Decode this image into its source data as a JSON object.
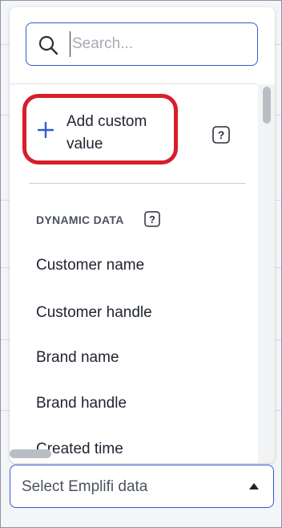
{
  "search": {
    "placeholder": "Search..."
  },
  "menu": {
    "add_custom_label": "Add custom value",
    "section_header": "DYNAMIC DATA",
    "items": [
      "Customer name",
      "Customer handle",
      "Brand name",
      "Brand handle",
      "Created time"
    ]
  },
  "select": {
    "label": "Select Emplifi data"
  },
  "colors": {
    "accent": "#2f5dc9",
    "highlight": "#d71e2b",
    "text": "#1e2330"
  },
  "icons": {
    "search": "search-icon",
    "plus": "plus-icon",
    "help": "help-icon",
    "caret": "caret-up-icon"
  }
}
